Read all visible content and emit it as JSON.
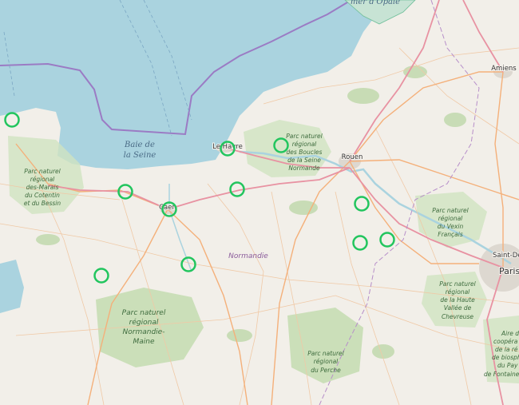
{
  "map": {
    "labels": {
      "sea_line1": "Baie de",
      "sea_line2": "la Seine",
      "opale": "mer d'Opale",
      "le_havre": "Le Havre",
      "rouen": "Rouen",
      "caen": "Caen",
      "amiens": "Amiens",
      "saint_denis": "Saint-De",
      "paris": "Paris",
      "normandie": "Normandie"
    },
    "parks": {
      "marais": [
        "Parc naturel",
        "régional",
        "des-Marais",
        "du Cotentin",
        "et du Bessin"
      ],
      "boucles": [
        "Parc naturel",
        "régional",
        "des Boucles",
        "de la Seine",
        "Normande"
      ],
      "vexin": [
        "Parc naturel",
        "régional",
        "du Vexin",
        "Français"
      ],
      "haute_vallee": [
        "Parc naturel",
        "régional",
        "de la Haute",
        "Vallée de",
        "Chevreuse"
      ],
      "normandie_maine": [
        "Parc naturel",
        "régional",
        "Normandie-",
        "Maine"
      ],
      "perche": [
        "Parc naturel",
        "régional",
        "du Perche"
      ],
      "biosphere": [
        "Aire d",
        "coopéra",
        "de la ré",
        "de biosph",
        "du Pay",
        "de Fontaine"
      ]
    },
    "colors": {
      "sea": "#aad3df",
      "land": "#f2efe9",
      "marker": "#22c55e",
      "boundary": "#9b7bc4",
      "motorway": "#e892a2",
      "trunk": "#f4b07a"
    }
  },
  "markers": [
    {
      "id": "marker-cotentin"
    },
    {
      "id": "marker-calvados-west"
    },
    {
      "id": "marker-caen"
    },
    {
      "id": "marker-le-havre"
    },
    {
      "id": "marker-boucles"
    },
    {
      "id": "marker-pont-audemer"
    },
    {
      "id": "marker-vire"
    },
    {
      "id": "marker-falaise"
    },
    {
      "id": "marker-eure-north"
    },
    {
      "id": "marker-eure-south"
    },
    {
      "id": "marker-vernon"
    }
  ]
}
